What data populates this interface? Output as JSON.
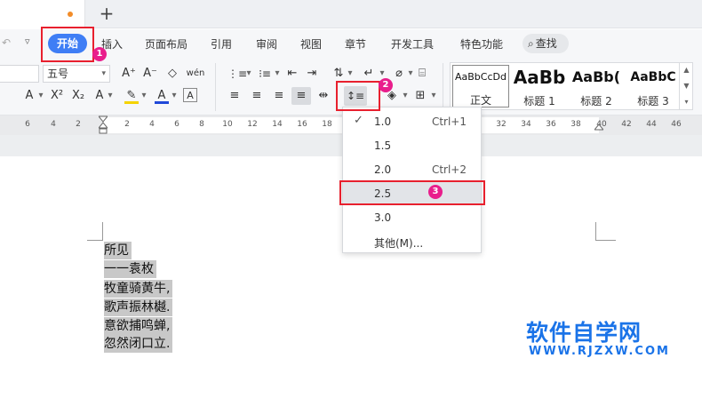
{
  "tabbar": {
    "new_tab_label": "+"
  },
  "menubar": {
    "items": [
      "插入",
      "页面布局",
      "引用",
      "审阅",
      "视图",
      "章节",
      "开发工具",
      "特色功能"
    ],
    "active_label": "开始",
    "search_label": "查找",
    "undo_icon": "↶",
    "quick_dropdown": "▿"
  },
  "ribbon": {
    "font_size": "五号",
    "font_size_arrow": "▾",
    "buttons": {
      "grow_font": "A⁺",
      "shrink_font": "A⁻",
      "clear_format": "◇",
      "phonetic": "wén",
      "superscript": "X²",
      "subscript": "X₂",
      "text_effect": "A",
      "highlight": "✎",
      "font_color": "A",
      "char_border": "A",
      "bullets": "⋮≡",
      "numbering": "⁝≡",
      "indent_less": "⇤",
      "indent_more": "⇥",
      "sort": "⇅",
      "show_marks": "↵",
      "align_left": "≡",
      "align_center": "≡",
      "align_right": "≡",
      "justify": "≡",
      "distributed": "⇹",
      "line_spacing": "↕≡",
      "shading": "◈",
      "borders": "⊞"
    },
    "styles": [
      {
        "sample": "AaBbCcDd",
        "caption": "正文"
      },
      {
        "sample": "AaBb",
        "caption": "标题 1"
      },
      {
        "sample": "AaBb(",
        "caption": "标题 2"
      },
      {
        "sample": "AaBbC",
        "caption": "标题 3"
      }
    ],
    "gallery_up": "▲",
    "gallery_down": "▼",
    "gallery_more": "▾"
  },
  "ruler": {
    "labels": [
      "6",
      "4",
      "2",
      "2",
      "4",
      "6",
      "8",
      "10",
      "12",
      "14",
      "16",
      "18",
      "20",
      "22",
      "24",
      "26",
      "28",
      "30",
      "32",
      "34",
      "36",
      "38",
      "40",
      "42",
      "44",
      "46"
    ]
  },
  "document": {
    "lines": [
      "所见",
      "一一袁枚",
      "牧童骑黄牛,",
      "歌声振林樾.",
      "意欲捕鸣蝉,",
      "忽然闭口立."
    ]
  },
  "line_spacing_menu": {
    "items": [
      {
        "label": "1.0",
        "shortcut": "Ctrl+1",
        "checked": true
      },
      {
        "label": "1.5",
        "shortcut": "",
        "checked": false
      },
      {
        "label": "2.0",
        "shortcut": "Ctrl+2",
        "checked": false
      },
      {
        "label": "2.5",
        "shortcut": "",
        "checked": false
      },
      {
        "label": "3.0",
        "shortcut": "",
        "checked": false
      },
      {
        "label": "其他(M)...",
        "shortcut": "",
        "checked": false
      }
    ],
    "check_glyph": "✓"
  },
  "annotations": {
    "step1": "1",
    "step2": "2",
    "step3": "3"
  },
  "watermark": {
    "cn": "软件自学网",
    "en": "WWW.RJZXW.COM"
  },
  "colors": {
    "accent": "#3f7ef5",
    "highlight_red": "#e8202e",
    "badge": "#e91e8c",
    "watermark": "#1a73e8"
  }
}
